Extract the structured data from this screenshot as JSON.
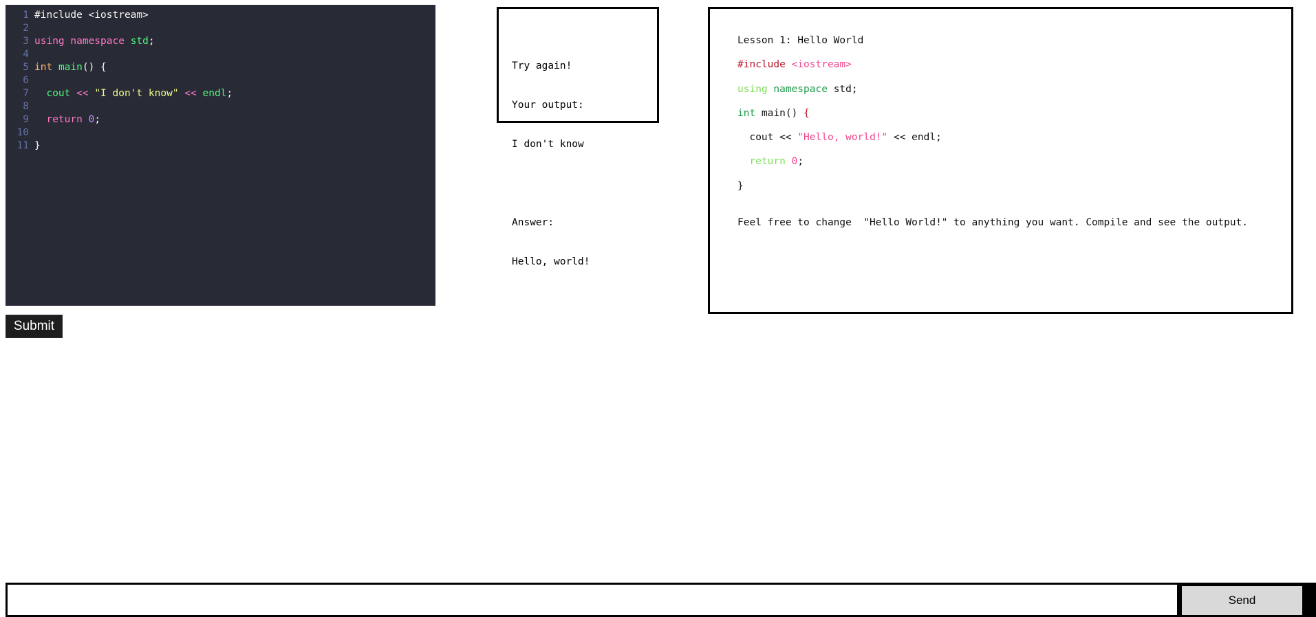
{
  "editor": {
    "lines": [
      {
        "num": "1",
        "tokens": [
          {
            "t": "#include <iostream>",
            "c": "plain"
          }
        ]
      },
      {
        "num": "2",
        "tokens": []
      },
      {
        "num": "3",
        "tokens": [
          {
            "t": "using",
            "c": "keyword"
          },
          {
            "t": " ",
            "c": "plain"
          },
          {
            "t": "namespace",
            "c": "keyword"
          },
          {
            "t": " ",
            "c": "plain"
          },
          {
            "t": "std",
            "c": "ident"
          },
          {
            "t": ";",
            "c": "plain"
          }
        ]
      },
      {
        "num": "4",
        "tokens": []
      },
      {
        "num": "5",
        "tokens": [
          {
            "t": "int",
            "c": "type"
          },
          {
            "t": " ",
            "c": "plain"
          },
          {
            "t": "main",
            "c": "func"
          },
          {
            "t": "() {",
            "c": "plain"
          }
        ]
      },
      {
        "num": "6",
        "tokens": []
      },
      {
        "num": "7",
        "tokens": [
          {
            "t": "  ",
            "c": "plain"
          },
          {
            "t": "cout",
            "c": "ident"
          },
          {
            "t": " ",
            "c": "plain"
          },
          {
            "t": "<<",
            "c": "keyword"
          },
          {
            "t": " ",
            "c": "plain"
          },
          {
            "t": "\"I don't know\"",
            "c": "string"
          },
          {
            "t": " ",
            "c": "plain"
          },
          {
            "t": "<<",
            "c": "keyword"
          },
          {
            "t": " ",
            "c": "plain"
          },
          {
            "t": "endl",
            "c": "ident"
          },
          {
            "t": ";",
            "c": "plain"
          }
        ]
      },
      {
        "num": "8",
        "tokens": []
      },
      {
        "num": "9",
        "tokens": [
          {
            "t": "  ",
            "c": "plain"
          },
          {
            "t": "return",
            "c": "keyword"
          },
          {
            "t": " ",
            "c": "plain"
          },
          {
            "t": "0",
            "c": "number"
          },
          {
            "t": ";",
            "c": "plain"
          }
        ]
      },
      {
        "num": "10",
        "tokens": []
      },
      {
        "num": "11",
        "tokens": [
          {
            "t": "}",
            "c": "plain"
          }
        ]
      }
    ]
  },
  "submit_label": "Submit",
  "output": {
    "status": "Try again!",
    "your_output_label": "Your output:",
    "your_output_value": "I don't know",
    "answer_label": "Answer:",
    "answer_value": "Hello, world!"
  },
  "lesson": {
    "title": "Lesson 1: Hello World",
    "code": [
      [
        {
          "t": "#include ",
          "c": "red"
        },
        {
          "t": "<iostream>",
          "c": "pink"
        }
      ],
      [
        {
          "t": "using",
          "c": "lime"
        },
        {
          "t": " ",
          "c": "plain"
        },
        {
          "t": "namespace",
          "c": "green"
        },
        {
          "t": " std;",
          "c": "plain"
        }
      ],
      [
        {
          "t": "int",
          "c": "green"
        },
        {
          "t": " main() ",
          "c": "plain"
        },
        {
          "t": "{",
          "c": "red"
        }
      ],
      [
        {
          "t": "  cout << ",
          "c": "plain"
        },
        {
          "t": "\"Hello, world!\"",
          "c": "pink"
        },
        {
          "t": " << endl;",
          "c": "plain"
        }
      ],
      [
        {
          "t": "  ",
          "c": "plain"
        },
        {
          "t": "return",
          "c": "lime"
        },
        {
          "t": " ",
          "c": "plain"
        },
        {
          "t": "0",
          "c": "pink"
        },
        {
          "t": ";",
          "c": "plain"
        }
      ],
      [
        {
          "t": "}",
          "c": "plain"
        }
      ]
    ],
    "note": "Feel free to change  \"Hello World!\" to anything you want. Compile and see the output."
  },
  "chat": {
    "input_value": "",
    "send_label": "Send"
  }
}
